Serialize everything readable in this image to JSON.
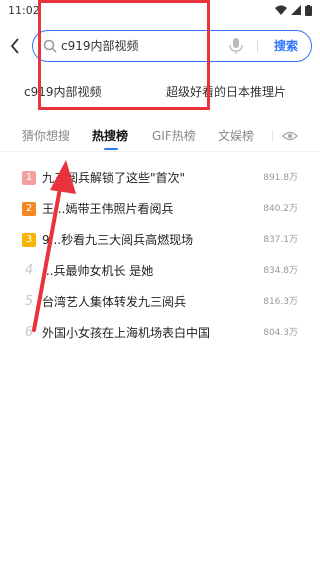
{
  "status_bar": {
    "time": "11:02"
  },
  "search": {
    "value": "c919内部视频",
    "button_label": "搜索"
  },
  "suggestions": [
    "c919内部视频",
    "超级好看的日本推理片"
  ],
  "tabs": [
    {
      "label": "猜你想搜",
      "active": false
    },
    {
      "label": "热搜榜",
      "active": true
    },
    {
      "label": "GIF热榜",
      "active": false
    },
    {
      "label": "文娱榜",
      "active": false
    }
  ],
  "hot_list": [
    {
      "rank": "1",
      "title": "九三阅兵解锁了这些\"首次\"",
      "count": "891.8万"
    },
    {
      "rank": "2",
      "title": "王...嫣带王伟照片看阅兵",
      "count": "840.2万"
    },
    {
      "rank": "3",
      "title": "9...秒看九三大阅兵高燃现场",
      "count": "837.1万"
    },
    {
      "rank": "4",
      "title": "...兵最帅女机长 是她",
      "count": "834.8万"
    },
    {
      "rank": "5",
      "title": "台湾艺人集体转发九三阅兵",
      "count": "816.3万"
    },
    {
      "rank": "6",
      "title": "外国小女孩在上海机场表白中国",
      "count": "804.3万"
    }
  ],
  "colors": {
    "accent": "#2f74ff",
    "rank1": "#f5a0a0",
    "rank2": "#f5891f",
    "rank3": "#f7b500",
    "annotation": "#e8323c"
  }
}
